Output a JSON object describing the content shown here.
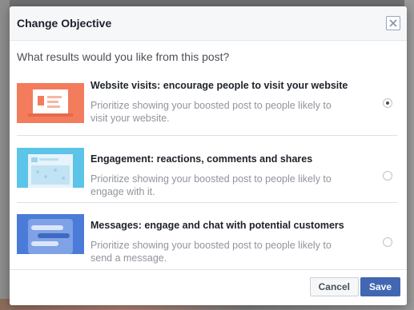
{
  "dialog": {
    "title": "Change Objective",
    "question": "What results would you like from this post?",
    "options": [
      {
        "title": "Website visits: encourage people to visit your website",
        "description": "Prioritize showing your boosted post to people likely to visit your website.",
        "selected": true,
        "icon": "website-illustration",
        "color": "#f27c5c"
      },
      {
        "title": "Engagement: reactions, comments and shares",
        "description": "Prioritize showing your boosted post to people likely to engage with it.",
        "selected": false,
        "icon": "engagement-illustration",
        "color": "#5bc4e8"
      },
      {
        "title": "Messages: engage and chat with potential customers",
        "description": "Prioritize showing your boosted post to people likely to send a message.",
        "selected": false,
        "icon": "messages-illustration",
        "color": "#4b7bd8"
      }
    ],
    "cancel_label": "Cancel",
    "save_label": "Save"
  }
}
